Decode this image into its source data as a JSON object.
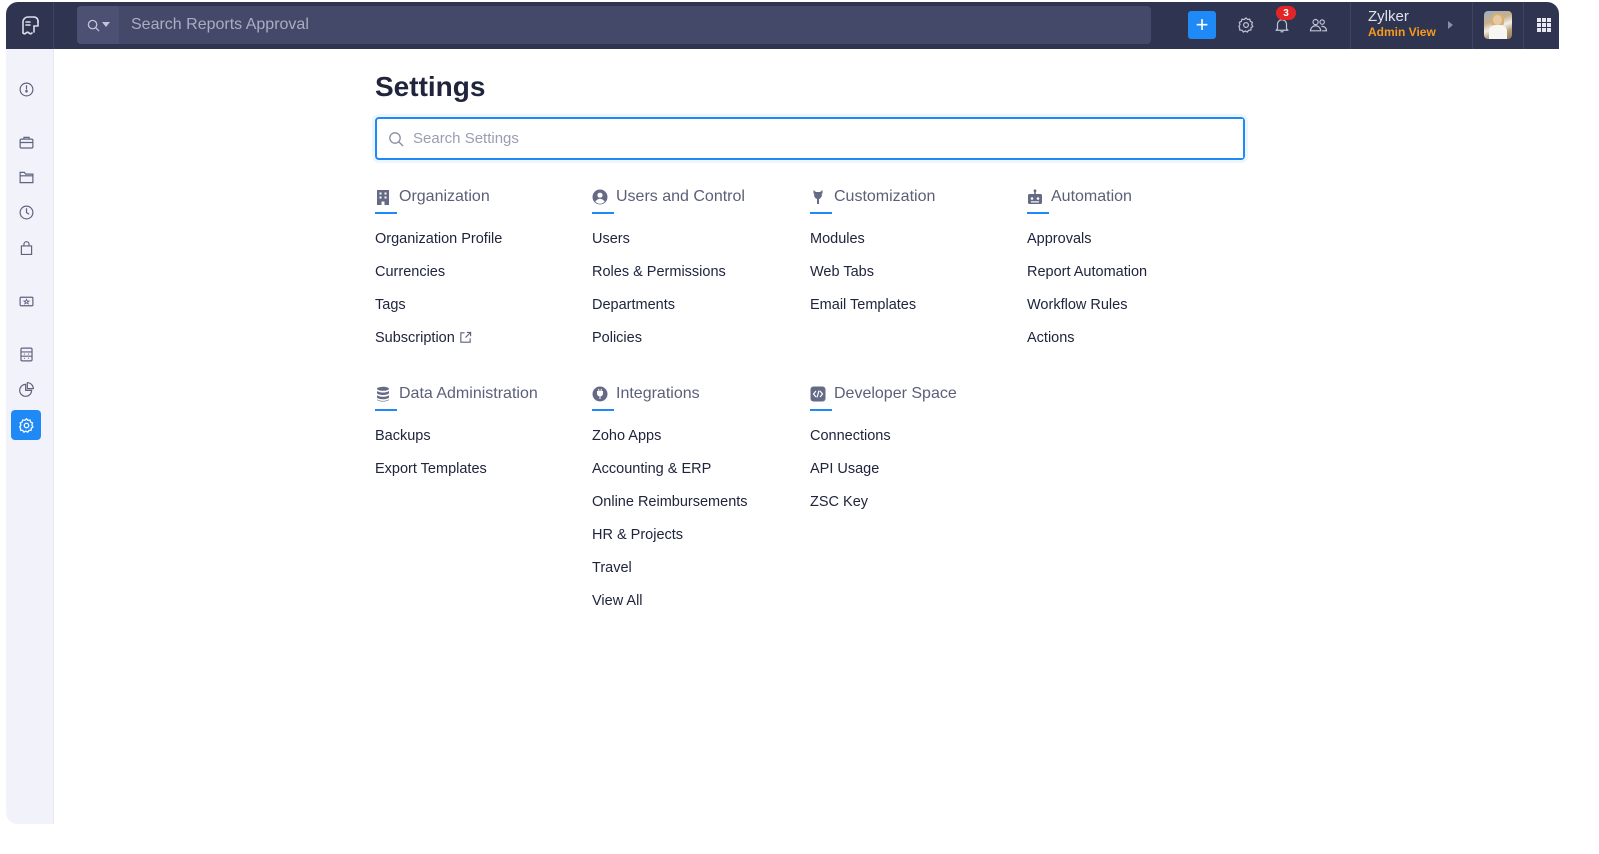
{
  "topbar": {
    "app_logo": "zoho-expense-logo",
    "search_placeholder": "Search Reports Approval",
    "add_button_label": "+",
    "notification_count": "3",
    "user": {
      "org_name": "Zylker",
      "role": "Admin View"
    },
    "colors": {
      "bar_bg": "#2f3450",
      "accent": "#1f8af5",
      "role_color": "#f89b1c",
      "badge": "#e42527"
    }
  },
  "sidebar": {
    "items": [
      {
        "name": "dashboard",
        "icon": "gauge-icon",
        "active": false
      },
      {
        "name": "trips",
        "icon": "briefcase-icon",
        "active": false
      },
      {
        "name": "reports",
        "icon": "folder-icon",
        "active": false
      },
      {
        "name": "approvals",
        "icon": "clock-arrow-icon",
        "active": false
      },
      {
        "name": "purchase-requests",
        "icon": "bag-icon",
        "active": false
      },
      {
        "name": "cards",
        "icon": "card-star-icon",
        "active": false
      },
      {
        "name": "budgets",
        "icon": "calculator-icon",
        "active": false
      },
      {
        "name": "analytics",
        "icon": "pie-chart-icon",
        "active": false
      },
      {
        "name": "settings",
        "icon": "gear-icon",
        "active": true
      }
    ]
  },
  "main": {
    "title": "Settings",
    "search_placeholder": "Search Settings",
    "sections": [
      {
        "title": "Organization",
        "icon": "building-icon",
        "links": [
          "Organization Profile",
          "Currencies",
          "Tags",
          "Subscription"
        ],
        "external_link_index": 3
      },
      {
        "title": "Users and Control",
        "icon": "user-circle-icon",
        "links": [
          "Users",
          "Roles & Permissions",
          "Departments",
          "Policies"
        ]
      },
      {
        "title": "Customization",
        "icon": "wrench-icon",
        "links": [
          "Modules",
          "Web Tabs",
          "Email Templates"
        ]
      },
      {
        "title": "Automation",
        "icon": "robot-icon",
        "links": [
          "Approvals",
          "Report Automation",
          "Workflow Rules",
          "Actions"
        ]
      },
      {
        "title": "Data Administration",
        "icon": "database-icon",
        "links": [
          "Backups",
          "Export Templates"
        ]
      },
      {
        "title": "Integrations",
        "icon": "plug-icon",
        "links": [
          "Zoho Apps",
          "Accounting & ERP",
          "Online Reimbursements",
          "HR & Projects",
          "Travel",
          "View All"
        ]
      },
      {
        "title": "Developer Space",
        "icon": "code-icon",
        "links": [
          "Connections",
          "API Usage",
          "ZSC Key"
        ]
      }
    ]
  }
}
